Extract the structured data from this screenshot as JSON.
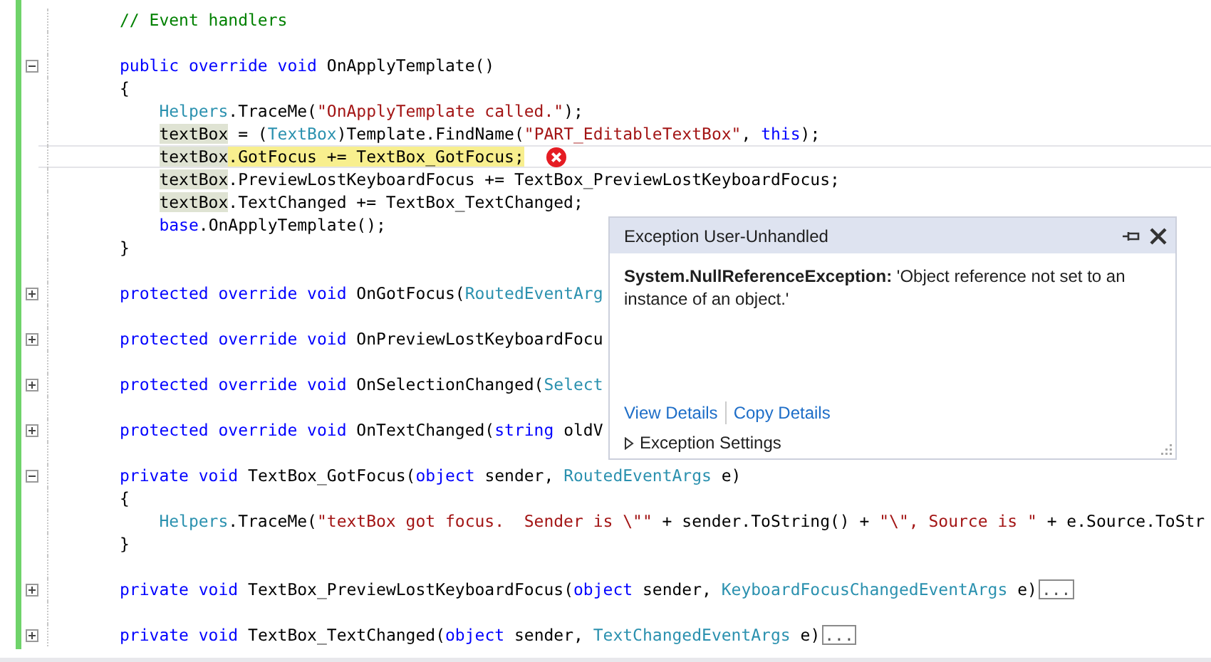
{
  "editor": {
    "lines": [
      {
        "kind": "code",
        "tokens": [
          {
            "kind": "comment",
            "text": "// Event handlers"
          }
        ]
      },
      {
        "kind": "blank"
      },
      {
        "kind": "code",
        "expanded": true,
        "tokens": [
          {
            "kind": "keyword",
            "text": "public override void "
          },
          {
            "kind": "plain",
            "text": "OnApplyTemplate()"
          }
        ]
      },
      {
        "kind": "code",
        "tokens": [
          {
            "kind": "plain",
            "text": "{"
          }
        ],
        "children": [
          {
            "kind": "code",
            "tokens": [
              {
                "kind": "type",
                "text": "Helpers"
              },
              {
                "kind": "plain",
                "text": ".TraceMe("
              },
              {
                "kind": "string",
                "text": "\"OnApplyTemplate called.\""
              },
              {
                "kind": "plain",
                "text": ");"
              }
            ]
          },
          {
            "kind": "code",
            "tokens": [
              {
                "kind": "ref",
                "text": "textBox"
              },
              {
                "kind": "plain",
                "text": " = ("
              },
              {
                "kind": "type",
                "text": "TextBox"
              },
              {
                "kind": "plain",
                "text": ")Template.FindName("
              },
              {
                "kind": "string",
                "text": "\"PART_EditableTextBox\""
              },
              {
                "kind": "plain",
                "text": ", "
              },
              {
                "kind": "keyword",
                "text": "this"
              },
              {
                "kind": "plain",
                "text": ");"
              }
            ]
          },
          {
            "kind": "code",
            "current": true,
            "tokens": [
              {
                "kind": "ref",
                "text": "textBox"
              },
              {
                "kind": "exec",
                "text": ".GotFocus += TextBox_GotFocus;"
              },
              {
                "kind": "error"
              }
            ]
          },
          {
            "kind": "code",
            "tokens": [
              {
                "kind": "ref",
                "text": "textBox"
              },
              {
                "kind": "plain",
                "text": ".PreviewLostKeyboardFocus += TextBox_PreviewLostKeyboardFocus;"
              }
            ]
          },
          {
            "kind": "code",
            "tokens": [
              {
                "kind": "ref",
                "text": "textBox"
              },
              {
                "kind": "plain",
                "text": ".TextChanged += TextBox_TextChanged;"
              }
            ]
          },
          {
            "kind": "code",
            "tokens": [
              {
                "kind": "keyword",
                "text": "base"
              },
              {
                "kind": "plain",
                "text": ".OnApplyTemplate();"
              }
            ]
          }
        ]
      },
      {
        "kind": "code",
        "tokens": [
          {
            "kind": "plain",
            "text": "}"
          }
        ]
      },
      {
        "kind": "blank"
      },
      {
        "kind": "code",
        "expanded": false,
        "tokens": [
          {
            "kind": "keyword",
            "text": "protected override void "
          },
          {
            "kind": "plain",
            "text": "OnGotFocus("
          },
          {
            "kind": "type",
            "text": "RoutedEventArg"
          }
        ]
      },
      {
        "kind": "blank"
      },
      {
        "kind": "code",
        "expanded": false,
        "tokens": [
          {
            "kind": "keyword",
            "text": "protected override void "
          },
          {
            "kind": "plain",
            "text": "OnPreviewLostKeyboardFocu"
          }
        ]
      },
      {
        "kind": "blank"
      },
      {
        "kind": "code",
        "expanded": false,
        "tokens": [
          {
            "kind": "keyword",
            "text": "protected override void "
          },
          {
            "kind": "plain",
            "text": "OnSelectionChanged("
          },
          {
            "kind": "type",
            "text": "Select"
          }
        ]
      },
      {
        "kind": "blank"
      },
      {
        "kind": "code",
        "expanded": false,
        "tokens": [
          {
            "kind": "keyword",
            "text": "protected override void "
          },
          {
            "kind": "plain",
            "text": "OnTextChanged("
          },
          {
            "kind": "keyword",
            "text": "string"
          },
          {
            "kind": "plain",
            "text": " oldV"
          }
        ]
      },
      {
        "kind": "blank"
      },
      {
        "kind": "code",
        "expanded": true,
        "tokens": [
          {
            "kind": "keyword",
            "text": "private void "
          },
          {
            "kind": "plain",
            "text": "TextBox_GotFocus("
          },
          {
            "kind": "keyword",
            "text": "object"
          },
          {
            "kind": "plain",
            "text": " sender, "
          },
          {
            "kind": "type",
            "text": "RoutedEventArgs"
          },
          {
            "kind": "plain",
            "text": " e)"
          }
        ]
      },
      {
        "kind": "code",
        "tokens": [
          {
            "kind": "plain",
            "text": "{"
          }
        ],
        "children": [
          {
            "kind": "code",
            "tokens": [
              {
                "kind": "type",
                "text": "Helpers"
              },
              {
                "kind": "plain",
                "text": ".TraceMe("
              },
              {
                "kind": "string",
                "text": "\"textBox got focus.  Sender is \\\"\""
              },
              {
                "kind": "plain",
                "text": " + sender.ToString() + "
              },
              {
                "kind": "string",
                "text": "\"\\\", Source is \""
              },
              {
                "kind": "plain",
                "text": " + e.Source.ToStr"
              }
            ]
          }
        ]
      },
      {
        "kind": "code",
        "tokens": [
          {
            "kind": "plain",
            "text": "}"
          }
        ]
      },
      {
        "kind": "blank"
      },
      {
        "kind": "code",
        "expanded": false,
        "tokens": [
          {
            "kind": "keyword",
            "text": "private void "
          },
          {
            "kind": "plain",
            "text": "TextBox_PreviewLostKeyboardFocus("
          },
          {
            "kind": "keyword",
            "text": "object"
          },
          {
            "kind": "plain",
            "text": " sender, "
          },
          {
            "kind": "type",
            "text": "KeyboardFocusChangedEventArgs"
          },
          {
            "kind": "plain",
            "text": " e)"
          },
          {
            "kind": "collapsed",
            "text": "..."
          }
        ]
      },
      {
        "kind": "blank"
      },
      {
        "kind": "code",
        "expanded": false,
        "tokens": [
          {
            "kind": "keyword",
            "text": "private void "
          },
          {
            "kind": "plain",
            "text": "TextBox_TextChanged("
          },
          {
            "kind": "keyword",
            "text": "object"
          },
          {
            "kind": "plain",
            "text": " sender, "
          },
          {
            "kind": "type",
            "text": "TextChangedEventArgs"
          },
          {
            "kind": "plain",
            "text": " e)"
          },
          {
            "kind": "collapsed",
            "text": "..."
          }
        ]
      }
    ]
  },
  "exception_popup": {
    "title": "Exception User-Unhandled",
    "message": "**System.NullReferenceException:** 'Object reference not set to an instance of an object.'",
    "links": [
      "View Details",
      "Copy Details"
    ],
    "settings": {
      "label": "Exception Settings",
      "expanded": false
    }
  }
}
